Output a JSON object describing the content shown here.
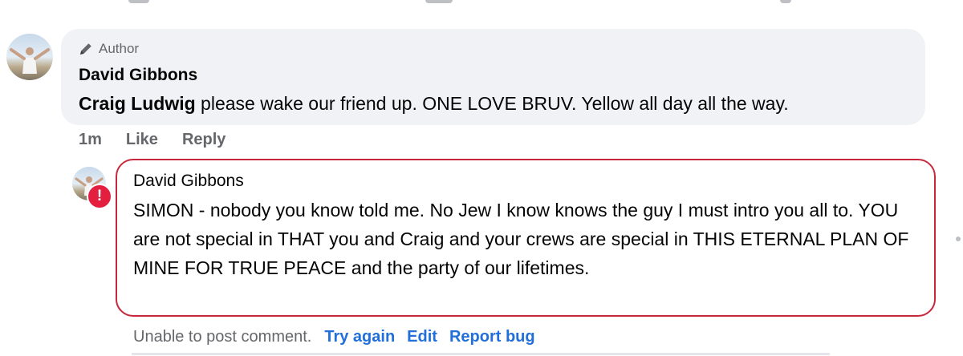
{
  "comment": {
    "badge_label": "Author",
    "author": "David Gibbons",
    "mention": "Craig Ludwig",
    "text": " please wake our friend up. ONE LOVE BRUV. Yellow all day all the way.",
    "timestamp": "1m",
    "like_label": "Like",
    "reply_label": "Reply"
  },
  "pending_reply": {
    "author": "David Gibbons",
    "text": "SIMON - nobody you know told me. No Jew I know knows the guy I must intro you all to. YOU are not special in THAT you and Craig and your crews are special in THIS ETERNAL PLAN OF MINE FOR TRUE PEACE and the party of our lifetimes.",
    "error_icon": "!",
    "error_text": "Unable to post comment.",
    "try_again_label": "Try again",
    "edit_label": "Edit",
    "report_label": "Report bug"
  },
  "colors": {
    "bubble_bg": "#f0f2f5",
    "error_red": "#e41e3f",
    "link_blue": "#216fdb",
    "secondary_text": "#65676b"
  }
}
